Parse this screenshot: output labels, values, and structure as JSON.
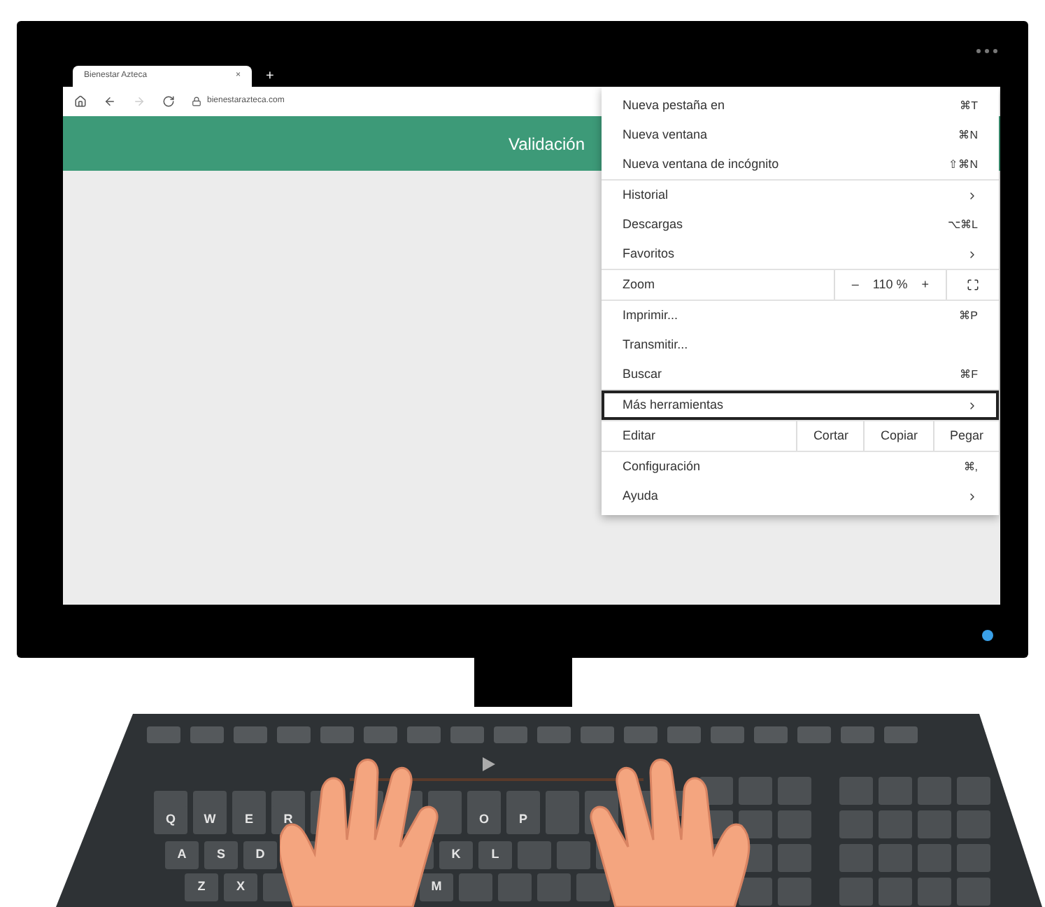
{
  "browser": {
    "tab": {
      "title": "Bienestar Azteca",
      "close": "×"
    },
    "new_tab": "+",
    "url": "bienestarazteca.com",
    "banner": "Validación"
  },
  "menu": {
    "sections": [
      [
        {
          "kind": "item",
          "label": "Nueva pestaña en",
          "shortcut": "⌘T",
          "selected": false
        },
        {
          "kind": "item",
          "label": "Nueva ventana",
          "shortcut": "⌘N",
          "selected": false
        },
        {
          "kind": "item",
          "label": "Nueva ventana de incógnito",
          "shortcut": "⇧⌘N",
          "selected": false
        }
      ],
      [
        {
          "kind": "submenu",
          "label": "Historial",
          "selected": false
        },
        {
          "kind": "item",
          "label": "Descargas",
          "shortcut": "⌥⌘L",
          "selected": false
        },
        {
          "kind": "submenu",
          "label": "Favoritos",
          "selected": false
        }
      ],
      [
        {
          "kind": "zoom",
          "label": "Zoom",
          "minus": "–",
          "value": "110 %",
          "plus": "+",
          "selected": false
        }
      ],
      [
        {
          "kind": "item",
          "label": "Imprimir...",
          "shortcut": "⌘P",
          "selected": false
        },
        {
          "kind": "item",
          "label": "Transmitir...",
          "selected": false
        },
        {
          "kind": "item",
          "label": "Buscar",
          "shortcut": "⌘F",
          "selected": false
        }
      ],
      [
        {
          "kind": "submenu",
          "label": "Más herramientas",
          "selected": true
        }
      ],
      [
        {
          "kind": "edit",
          "label": "Editar",
          "buttons": [
            "Cortar",
            "Copiar",
            "Pegar"
          ],
          "selected": false
        }
      ],
      [
        {
          "kind": "item",
          "label": "Configuración",
          "shortcut": "⌘,",
          "selected": false
        },
        {
          "kind": "submenu",
          "label": "Ayuda",
          "selected": false
        }
      ]
    ]
  },
  "keyboard": {
    "rows": [
      [
        "Q",
        "W",
        "E",
        "R",
        "O",
        "P"
      ],
      [
        "A",
        "S",
        "D",
        "K",
        "L"
      ],
      [
        "Z",
        "X",
        "M"
      ]
    ]
  }
}
